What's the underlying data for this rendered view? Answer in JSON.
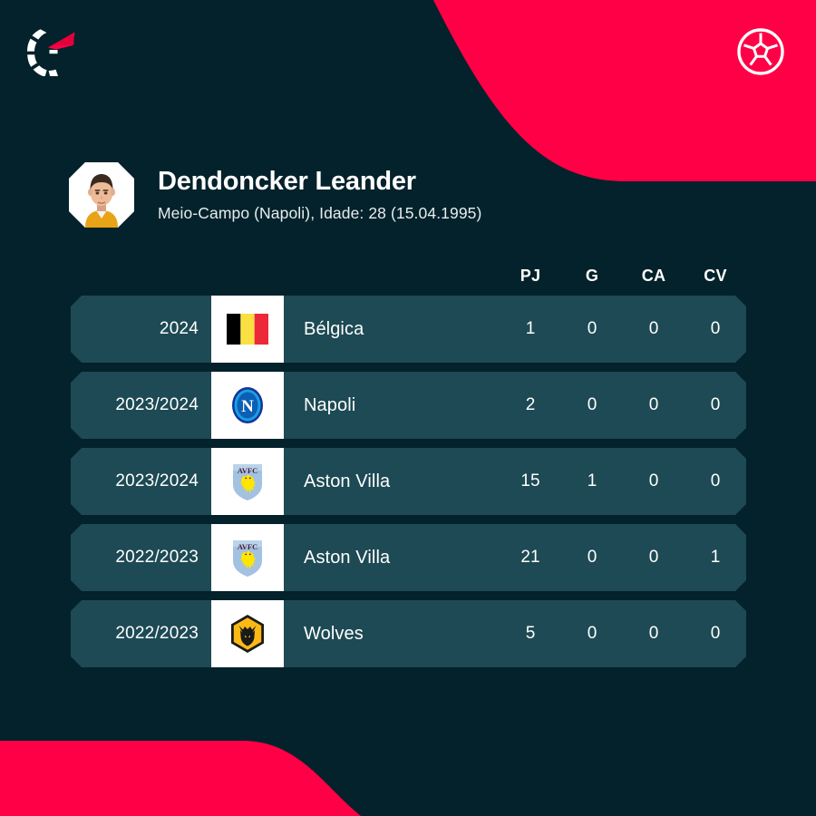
{
  "theme": {
    "background": "#04222b",
    "accent_pink": "#ff0046",
    "row_background": "#1d4a54",
    "text_primary": "#ffffff",
    "badge_tile": "#ffffff"
  },
  "header": {
    "brand_logo_name": "flashscore-logo",
    "ball_icon_name": "soccer-ball-icon"
  },
  "player": {
    "name": "Dendoncker Leander",
    "meta": "Meio-Campo (Napoli), Idade: 28 (15.04.1995)",
    "avatar_name": "player-avatar"
  },
  "table": {
    "columns": [
      "PJ",
      "G",
      "CA",
      "CV"
    ],
    "rows": [
      {
        "season": "2024",
        "team": "Bélgica",
        "badge": "belgium-flag",
        "stats": [
          "1",
          "0",
          "0",
          "0"
        ]
      },
      {
        "season": "2023/2024",
        "team": "Napoli",
        "badge": "napoli-crest",
        "stats": [
          "2",
          "0",
          "0",
          "0"
        ]
      },
      {
        "season": "2023/2024",
        "team": "Aston Villa",
        "badge": "aston-villa-crest",
        "stats": [
          "15",
          "1",
          "0",
          "0"
        ]
      },
      {
        "season": "2022/2023",
        "team": "Aston Villa",
        "badge": "aston-villa-crest",
        "stats": [
          "21",
          "0",
          "0",
          "1"
        ]
      },
      {
        "season": "2022/2023",
        "team": "Wolves",
        "badge": "wolves-crest",
        "stats": [
          "5",
          "0",
          "0",
          "0"
        ]
      }
    ]
  }
}
